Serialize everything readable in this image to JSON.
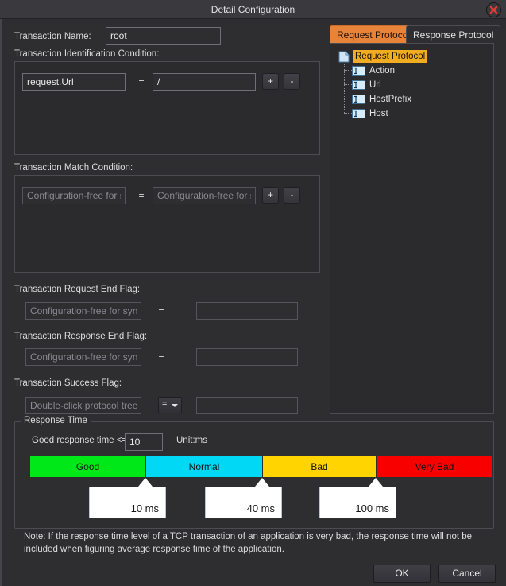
{
  "window": {
    "title": "Detail Configuration",
    "close_icon": "close-icon"
  },
  "form": {
    "transaction_name_label": "Transaction Name:",
    "transaction_name_value": "root",
    "identification_condition_label": "Transaction Identification Condition:",
    "identification_rows": [
      {
        "key_value": "request.Url",
        "operator": "=",
        "val_value": "/",
        "add_label": "+",
        "remove_label": "-"
      }
    ],
    "match_condition_label": "Transaction Match Condition:",
    "match_rows": [
      {
        "key_placeholder": "Configuration-free for s",
        "operator": "=",
        "val_placeholder": "Configuration-free for s",
        "add_label": "+",
        "remove_label": "-"
      }
    ],
    "request_end_flag_label": "Transaction Request End Flag:",
    "request_end_flag_placeholder": "Configuration-free for synchr",
    "request_end_flag_operator": "=",
    "request_end_flag_value": "",
    "response_end_flag_label": "Transaction Response End Flag:",
    "response_end_flag_placeholder": "Configuration-free for synchr",
    "response_end_flag_operator": "=",
    "response_end_flag_value": "",
    "success_flag_label": "Transaction Success Flag:",
    "success_flag_placeholder": "Double-click protocol tree to a",
    "success_flag_operator": "=",
    "success_flag_value": ""
  },
  "response_time": {
    "group_label": "Response Time",
    "good_label": "Good response time <=",
    "good_value": "10",
    "unit_label": "Unit:ms",
    "note": "Note: If the response time level of a TCP transaction of an application is very bad, the response time will not be included when figuring average response time of the application."
  },
  "chart_data": {
    "type": "bar",
    "title": "Response Time",
    "xlabel": "",
    "ylabel": "",
    "categories": [
      "Good",
      "Normal",
      "Bad",
      "Very Bad"
    ],
    "values": [
      10,
      40,
      100,
      100
    ],
    "unit": "ms",
    "boundaries": [
      {
        "label": "10 ms",
        "value": 10
      },
      {
        "label": "40 ms",
        "value": 40
      },
      {
        "label": "100 ms",
        "value": 100
      }
    ],
    "colors": {
      "good": "#00e817",
      "normal": "#00d8f5",
      "bad": "#ffd400",
      "very_bad": "#f90000"
    },
    "grid": false,
    "legend": "none"
  },
  "protocol": {
    "tabs": [
      {
        "label": "Request Protocol",
        "active": true
      },
      {
        "label": "Response Protocol",
        "active": false
      }
    ],
    "tree": {
      "root": {
        "label": "Request Protocol",
        "icon": "document-icon",
        "selected": true
      },
      "children": [
        {
          "label": "Action",
          "icon": "textfield-icon"
        },
        {
          "label": "Url",
          "icon": "textfield-icon"
        },
        {
          "label": "HostPrefix",
          "icon": "textfield-icon"
        },
        {
          "label": "Host",
          "icon": "textfield-icon"
        }
      ]
    }
  },
  "footer": {
    "ok_label": "OK",
    "cancel_label": "Cancel"
  }
}
